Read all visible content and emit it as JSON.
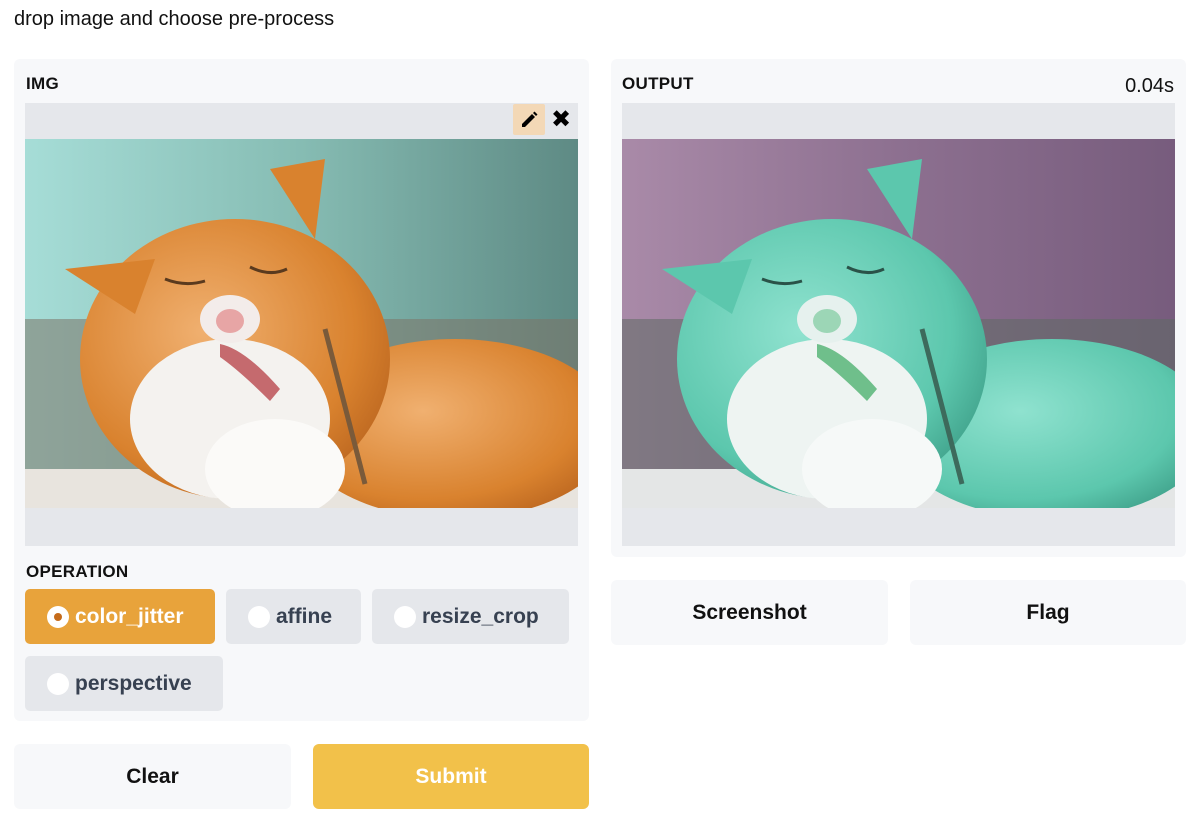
{
  "description": "drop image and choose pre-process",
  "input": {
    "label": "IMG",
    "edit_icon": "pencil-icon",
    "close_icon": "close-icon",
    "close_glyph": "✖"
  },
  "operation": {
    "label": "OPERATION",
    "options": [
      "color_jitter",
      "affine",
      "resize_crop",
      "perspective"
    ],
    "selected": "color_jitter"
  },
  "output": {
    "label": "OUTPUT",
    "timer": "0.04s"
  },
  "buttons": {
    "clear": "Clear",
    "submit": "Submit",
    "screenshot": "Screenshot",
    "flag": "Flag"
  },
  "colors": {
    "primary": "#f2c14a",
    "selected_radio": "#e8a33b",
    "panel": "#f7f8fa"
  }
}
